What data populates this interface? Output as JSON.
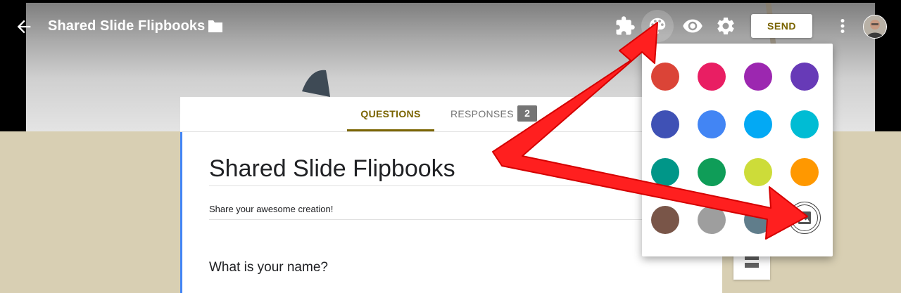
{
  "header": {
    "title": "Shared Slide Flipbooks",
    "send_label": "SEND",
    "icons": [
      "back-arrow-icon",
      "folder-icon",
      "addon-puzzle-icon",
      "palette-icon",
      "eye-icon",
      "gear-icon",
      "more-vert-icon"
    ]
  },
  "tabs": {
    "questions_label": "QUESTIONS",
    "responses_label": "RESPONSES",
    "responses_count": "2"
  },
  "form": {
    "title": "Shared Slide Flipbooks",
    "description": "Share your awesome creation!",
    "question_title": "What is your name?"
  },
  "theme_colors": [
    "#db4437",
    "#e91e63",
    "#9c27b0",
    "#673ab7",
    "#3f51b5",
    "#4285f4",
    "#03a9f4",
    "#00bcd4",
    "#009688",
    "#0f9d58",
    "#cddc39",
    "#ff9800",
    "#795548",
    "#9e9e9e",
    "#607d8b"
  ],
  "colors": {
    "accent": "#7a6400",
    "form_accent": "#4285f4",
    "page_background": "#d8cfb3",
    "annotation_arrow": "#ff1f1f"
  }
}
